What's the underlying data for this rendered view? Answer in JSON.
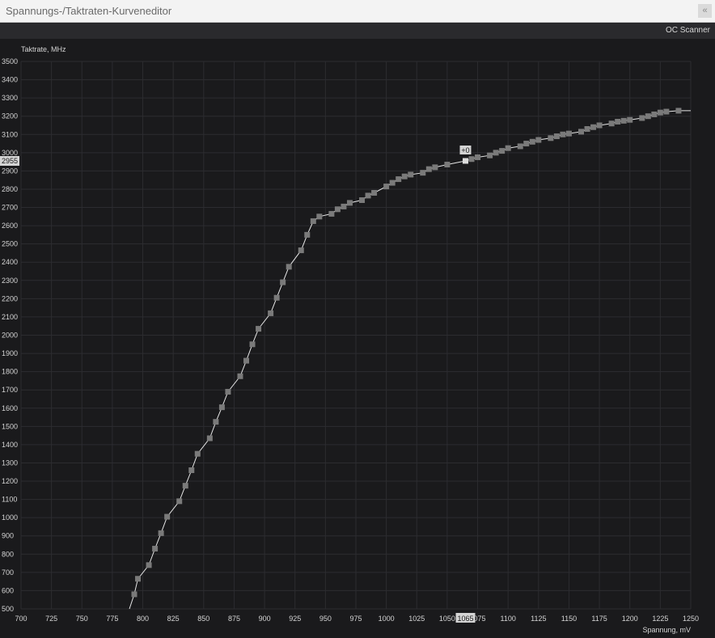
{
  "window": {
    "title": "Spannungs-/Taktraten-Kurveneditor",
    "close_glyph": "«"
  },
  "toolbar": {
    "oc_scanner_label": "OC Scanner"
  },
  "colors": {
    "background": "#1a1a1c",
    "grid": "#2c2c30",
    "curve": "#e6e6e6",
    "point": "#7a7a7a",
    "selected_point": "#dcdcdc",
    "label_bg": "#d4d4d4"
  },
  "chart_data": {
    "type": "line",
    "ylabel": "Taktrate, MHz",
    "xlabel": "Spannung, mV",
    "xlim": [
      700,
      1250
    ],
    "ylim": [
      500,
      3500
    ],
    "x_ticks": [
      700,
      725,
      750,
      775,
      800,
      825,
      850,
      875,
      900,
      925,
      950,
      975,
      1000,
      1025,
      1050,
      1075,
      1100,
      1125,
      1150,
      1175,
      1200,
      1225,
      1250
    ],
    "y_ticks": [
      500,
      600,
      700,
      800,
      900,
      1000,
      1100,
      1200,
      1300,
      1400,
      1500,
      1600,
      1700,
      1800,
      1900,
      2000,
      2100,
      2200,
      2300,
      2400,
      2500,
      2600,
      2700,
      2800,
      2900,
      3000,
      3100,
      3200,
      3300,
      3400,
      3500
    ],
    "grid": true,
    "selected_point": {
      "voltage": 1065,
      "clock": 2955,
      "offset_label": "+0"
    },
    "series": [
      {
        "points": [
          [
            789,
            500
          ],
          [
            793,
            580
          ],
          [
            796,
            665
          ],
          [
            805,
            740
          ],
          [
            810,
            830
          ],
          [
            815,
            915
          ],
          [
            820,
            1005
          ],
          [
            830,
            1090
          ],
          [
            835,
            1175
          ],
          [
            840,
            1260
          ],
          [
            845,
            1350
          ],
          [
            855,
            1435
          ],
          [
            860,
            1525
          ],
          [
            865,
            1605
          ],
          [
            870,
            1690
          ],
          [
            880,
            1775
          ],
          [
            885,
            1860
          ],
          [
            890,
            1950
          ],
          [
            895,
            2035
          ],
          [
            905,
            2120
          ],
          [
            910,
            2205
          ],
          [
            915,
            2290
          ],
          [
            920,
            2375
          ],
          [
            930,
            2465
          ],
          [
            935,
            2550
          ],
          [
            940,
            2625
          ],
          [
            945,
            2650
          ],
          [
            955,
            2665
          ],
          [
            960,
            2690
          ],
          [
            965,
            2705
          ],
          [
            970,
            2725
          ],
          [
            980,
            2740
          ],
          [
            985,
            2765
          ],
          [
            990,
            2780
          ],
          [
            1000,
            2815
          ],
          [
            1005,
            2835
          ],
          [
            1010,
            2855
          ],
          [
            1015,
            2870
          ],
          [
            1020,
            2880
          ],
          [
            1030,
            2890
          ],
          [
            1035,
            2910
          ],
          [
            1040,
            2920
          ],
          [
            1050,
            2935
          ],
          [
            1065,
            2955
          ],
          [
            1070,
            2965
          ],
          [
            1075,
            2975
          ],
          [
            1085,
            2985
          ],
          [
            1090,
            3000
          ],
          [
            1095,
            3010
          ],
          [
            1100,
            3025
          ],
          [
            1110,
            3035
          ],
          [
            1115,
            3050
          ],
          [
            1120,
            3060
          ],
          [
            1125,
            3070
          ],
          [
            1135,
            3080
          ],
          [
            1140,
            3090
          ],
          [
            1145,
            3100
          ],
          [
            1150,
            3105
          ],
          [
            1160,
            3115
          ],
          [
            1165,
            3130
          ],
          [
            1170,
            3140
          ],
          [
            1175,
            3150
          ],
          [
            1185,
            3160
          ],
          [
            1190,
            3170
          ],
          [
            1195,
            3175
          ],
          [
            1200,
            3180
          ],
          [
            1210,
            3190
          ],
          [
            1215,
            3200
          ],
          [
            1220,
            3210
          ],
          [
            1225,
            3220
          ],
          [
            1230,
            3225
          ],
          [
            1240,
            3230
          ],
          [
            1250,
            3230
          ]
        ]
      }
    ]
  }
}
